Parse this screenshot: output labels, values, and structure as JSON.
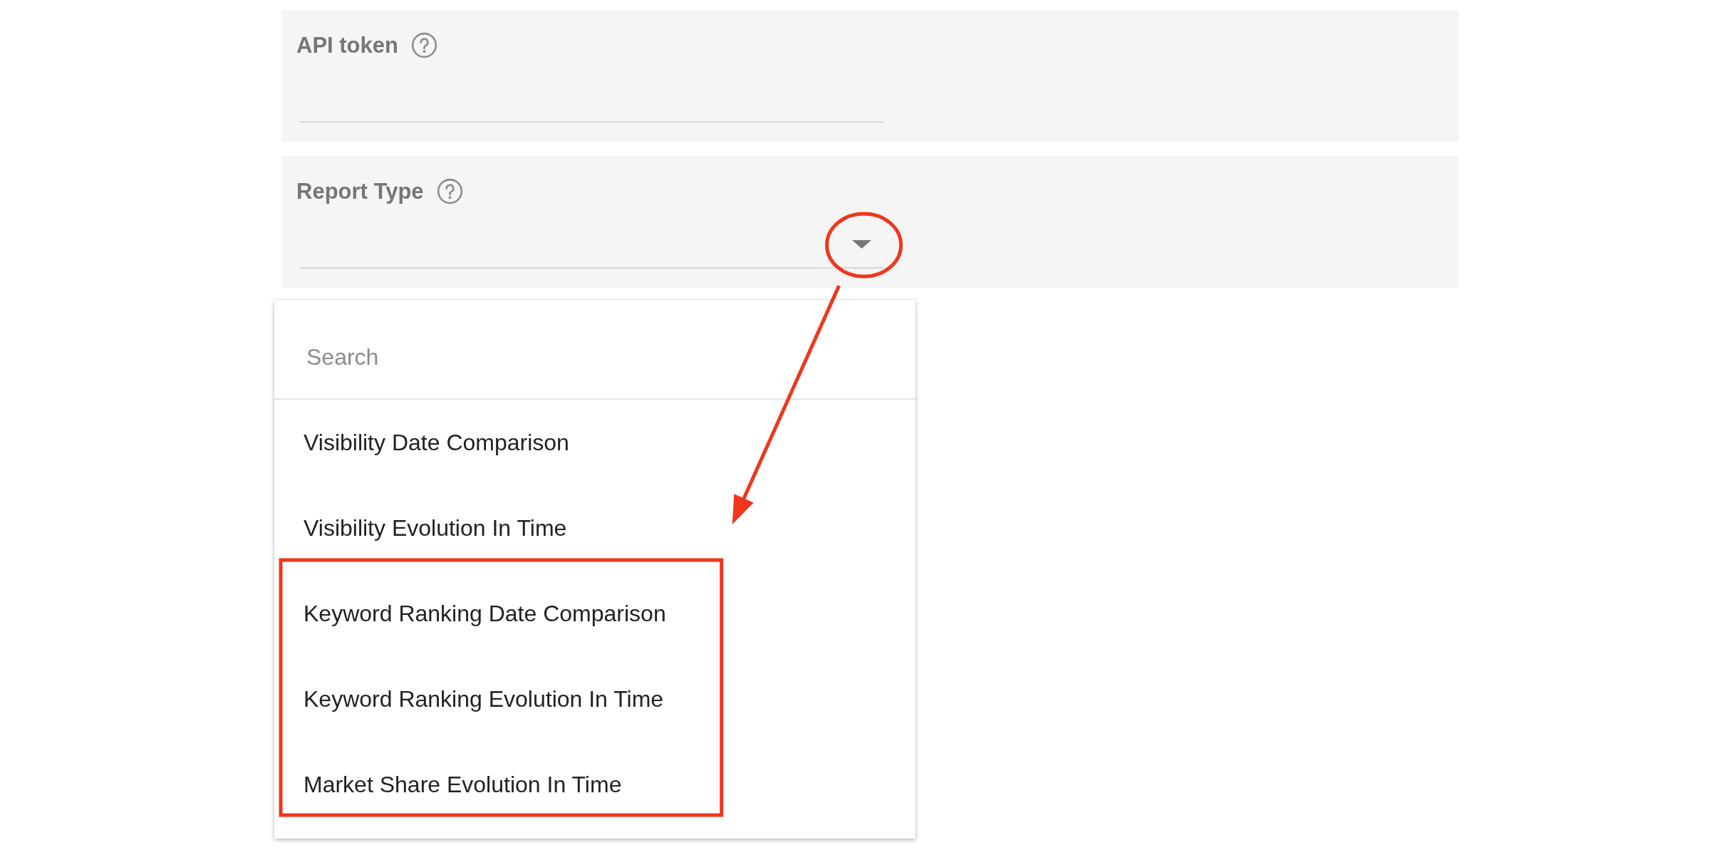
{
  "form": {
    "fields": [
      {
        "kind": "text",
        "label": "API token",
        "circled": false
      },
      {
        "kind": "select",
        "label": "Report Type",
        "circled": true
      }
    ]
  },
  "dropdown": {
    "search": {
      "placeholder": "Search"
    },
    "options": [
      {
        "label": "Visibility Date Comparison",
        "selected": false,
        "highlighted": false
      },
      {
        "label": "Visibility Evolution In Time",
        "selected": false,
        "highlighted": false
      },
      {
        "label": "Keyword Ranking Date Comparison",
        "selected": false,
        "highlighted": true
      },
      {
        "label": "Keyword Ranking Evolution In Time",
        "selected": false,
        "highlighted": true
      },
      {
        "label": "Market Share Evolution In Time",
        "selected": false,
        "highlighted": true
      }
    ]
  },
  "annotation": {
    "arrow": true
  }
}
